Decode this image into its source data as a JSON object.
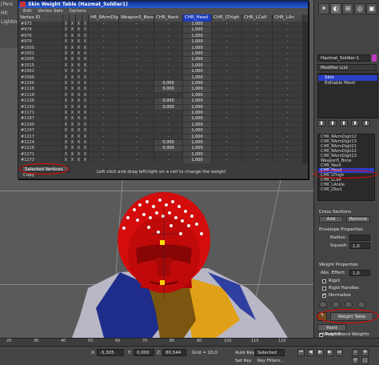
{
  "app": {
    "left_strip": [
      "[Pers",
      "Hit",
      "Lighting"
    ],
    "colors": {
      "accent": "#1c3dbd",
      "highlight_ring": "#e00000",
      "head_red": "#d40c0c"
    }
  },
  "weight_table": {
    "title": "Skin Weight Table (Hazmat_Soldier1)",
    "menu": [
      "Edit",
      "Vertex Sets",
      "Options"
    ],
    "columns": [
      "Vertex ID",
      "",
      "",
      "",
      "",
      "HR_RArmDigit13",
      "Weapon5_Bone",
      "CHR_Neck",
      "CHR_Head",
      "CHR_LThigh",
      "CHR_LCalf",
      "CHR_LAn"
    ],
    "selected_column": "CHR_Head",
    "rows": [
      {
        "id": "#973",
        "w": [
          "-",
          "-",
          "-",
          "1,000",
          "-",
          "-",
          "-"
        ]
      },
      {
        "id": "#974",
        "w": [
          "-",
          "-",
          "-",
          "1,000",
          "-",
          "-",
          "-"
        ]
      },
      {
        "id": "#976",
        "w": [
          "-",
          "-",
          "-",
          "1,000",
          "-",
          "-",
          "-"
        ]
      },
      {
        "id": "#979",
        "w": [
          "-",
          "-",
          "-",
          "1,000",
          "-",
          "-",
          "-"
        ]
      },
      {
        "id": "#1000",
        "w": [
          "-",
          "-",
          "-",
          "1,000",
          "-",
          "-",
          "-"
        ]
      },
      {
        "id": "#1001",
        "w": [
          "-",
          "-",
          "-",
          "1,000",
          "-",
          "-",
          "-"
        ]
      },
      {
        "id": "#1005",
        "w": [
          "-",
          "-",
          "-",
          "1,000",
          "-",
          "-",
          "-"
        ]
      },
      {
        "id": "#1015",
        "w": [
          "-",
          "-",
          "-",
          "1,000",
          "-",
          "-",
          "-"
        ]
      },
      {
        "id": "#1062",
        "w": [
          "-",
          "-",
          "-",
          "1,000",
          "-",
          "-",
          "-"
        ]
      },
      {
        "id": "#1096",
        "w": [
          "-",
          "-",
          "-",
          "1,000",
          "-",
          "-",
          "-"
        ]
      },
      {
        "id": "#1100",
        "w": [
          "-",
          "-",
          "0,000",
          "1,000",
          "-",
          "-",
          "-"
        ]
      },
      {
        "id": "#1116",
        "w": [
          "-",
          "-",
          "0,000",
          "1,000",
          "-",
          "-",
          "-"
        ]
      },
      {
        "id": "#1118",
        "w": [
          "-",
          "-",
          "-",
          "1,000",
          "-",
          "-",
          "-"
        ]
      },
      {
        "id": "#1136",
        "w": [
          "-",
          "-",
          "0,000",
          "1,000",
          "-",
          "-",
          "-"
        ]
      },
      {
        "id": "#1150",
        "w": [
          "-",
          "-",
          "0,000",
          "1,000",
          "-",
          "-",
          "-"
        ]
      },
      {
        "id": "#1171",
        "w": [
          "-",
          "-",
          "-",
          "1,000",
          "-",
          "-",
          "-"
        ]
      },
      {
        "id": "#1187",
        "w": [
          "-",
          "-",
          "-",
          "1,000",
          "-",
          "-",
          "-"
        ]
      },
      {
        "id": "#1190",
        "w": [
          "-",
          "-",
          "-",
          "1,000",
          "-",
          "-",
          "-"
        ]
      },
      {
        "id": "#1197",
        "w": [
          "-",
          "-",
          "-",
          "1,000",
          "-",
          "-",
          "-"
        ]
      },
      {
        "id": "#1217",
        "w": [
          "-",
          "-",
          "-",
          "1,000",
          "-",
          "-",
          "-"
        ]
      },
      {
        "id": "#1224",
        "w": [
          "-",
          "-",
          "0,000",
          "1,000",
          "-",
          "-",
          "-"
        ]
      },
      {
        "id": "#1226",
        "w": [
          "-",
          "-",
          "0,000",
          "1,000",
          "-",
          "-",
          "-"
        ]
      },
      {
        "id": "#1271",
        "w": [
          "-",
          "-",
          "-",
          "1,000",
          "-",
          "-",
          "-"
        ]
      },
      {
        "id": "#1273",
        "w": [
          "-",
          "-",
          "-",
          "1,000",
          "-",
          "-",
          "-"
        ]
      }
    ],
    "flags": [
      "X",
      "X",
      "X",
      "X"
    ],
    "selection_dropdown": "Selected Vertices",
    "copy_label": "Copy",
    "status_text": "Left click and drag left/right on a cell to change the weight"
  },
  "command_panel": {
    "object_name": "Hazmat_Soldier-1",
    "modifier_list": "Modifier List",
    "stack": [
      "Skin",
      "Editable Mesh"
    ],
    "bones": [
      "CHR_RArmDigit12",
      "CHR_RArmDigit13",
      "CHR_RArmDigit21",
      "CHR_RArmDigit22",
      "CHR_RArmDigit23",
      "Weapon5_Bone",
      "CHR_Neck",
      "CHR_Head",
      "CHR_LThigh",
      "CHR_LCalf",
      "CHR_LAnkle",
      "CHR_LToe1"
    ],
    "selected_bone": "CHR_Head",
    "cross_sections": "Cross Sections",
    "add_label": "Add",
    "remove_label": "Remove",
    "envelope_properties": "Envelope Properties",
    "radius_label": "Radius:",
    "squash_label": "Squash:",
    "squash_value": "1,0",
    "weight_properties": "Weight Properties",
    "abs_effect_label": "Abs. Effect:",
    "abs_effect_value": "1,0",
    "rigid_label": "Rigid",
    "rigid_handles_label": "Rigid Handles",
    "normalize_label": "Normalize",
    "weight_table_label": "Weight Table",
    "paint_weights_label": "Paint Weights",
    "paint_blend_label": "Paint Blend Weights"
  },
  "timeline": {
    "ticks": [
      "20",
      "30",
      "40",
      "50",
      "60",
      "70",
      "80",
      "90",
      "100",
      "110",
      "120"
    ]
  },
  "statusbar": {
    "x_label": "X:",
    "x_value": "-5,305",
    "y_label": "Y:",
    "y_value": "0,000",
    "z_label": "Z:",
    "z_value": "80,544",
    "grid_label": "Grid = 10,0",
    "auto_key": "Auto Key",
    "set_key": "Set Key",
    "selected": "Selected",
    "key_filters": "Key Filters..."
  }
}
